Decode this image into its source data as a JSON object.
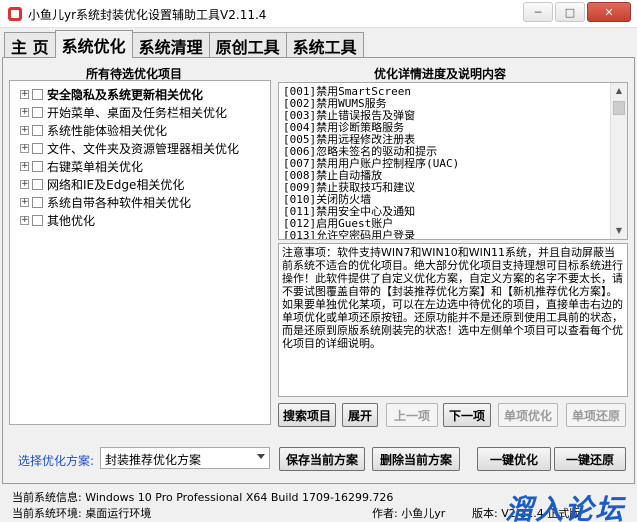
{
  "window": {
    "title": "小鱼儿yr系统封装优化设置辅助工具V2.11.4"
  },
  "tabs": [
    {
      "label": "主 页"
    },
    {
      "label": "系统优化"
    },
    {
      "label": "系统清理"
    },
    {
      "label": "原创工具"
    },
    {
      "label": "系统工具"
    }
  ],
  "left": {
    "title": "所有待选优化项目",
    "items": [
      {
        "label": "安全隐私及系统更新相关优化"
      },
      {
        "label": "开始菜单、桌面及任务栏相关优化"
      },
      {
        "label": "系统性能体验相关优化"
      },
      {
        "label": "文件、文件夹及资源管理器相关优化"
      },
      {
        "label": "右键菜单相关优化"
      },
      {
        "label": "网络和IE及Edge相关优化"
      },
      {
        "label": "系统自带各种软件相关优化"
      },
      {
        "label": "其他优化"
      }
    ]
  },
  "right": {
    "title": "优化详情进度及说明内容",
    "list": [
      "[001]禁用SmartScreen",
      "[002]禁用WUMS服务",
      "[003]禁止错误报告及弹窗",
      "[004]禁用诊断策略服务",
      "[005]禁用远程修改注册表",
      "[006]忽略未签名的驱动和提示",
      "[007]禁用用户账户控制程序(UAC)",
      "[008]禁止自动播放",
      "[009]禁止获取技巧和建议",
      "[010]关闭防火墙",
      "[011]禁用安全中心及通知",
      "[012]启用Guest账户",
      "[013]允许空密码用户登录"
    ],
    "notes": "注意事项：软件支持WIN7和WIN10和WIN11系统，并且自动屏蔽当前系统不适合的优化项目。绝大部分优化项目支持理想可目标系统进行操作！此软件提供了自定义优化方案，自定义方案的名字不要太长，请不要试图覆盖自带的【封装推荐优化方案】和【新机推荐优化方案】。如果要单独优化某项，可以在左边选中待优化的项目，直接单击右边的单项优化或单项还原按钮。还原功能并不是还原到使用工具前的状态，而是还原到原版系统刚装完的状态！选中左侧单个项目可以查看每个优化项目的详细说明。"
  },
  "buttons": {
    "search": "搜索项目",
    "expand": "展开",
    "prev": "上一项",
    "next": "下一项",
    "single_opt": "单项优化",
    "single_restore": "单项还原",
    "save_scheme": "保存当前方案",
    "delete_scheme": "删除当前方案",
    "one_click_opt": "一键优化",
    "one_click_restore": "一键还原"
  },
  "scheme": {
    "label": "选择优化方案:",
    "selected": "封装推荐优化方案"
  },
  "status": {
    "system_info": "当前系统信息: Windows 10 Pro Professional X64 Build 1709-16299.726",
    "system_env": "当前系统环境: 桌面运行环境",
    "author": "作者: 小鱼儿yr",
    "version": "版本: V2.11.4 正式版"
  },
  "watermark": "溜入论坛"
}
